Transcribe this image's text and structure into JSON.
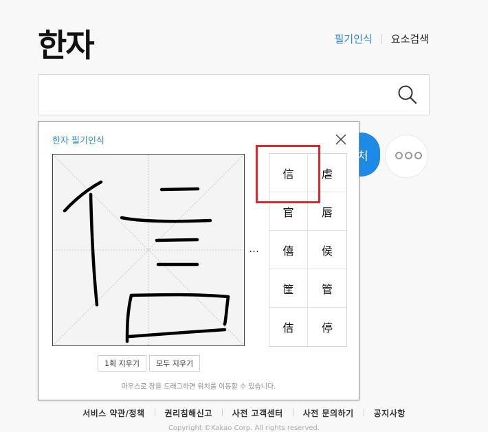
{
  "header": {
    "logo": "한자",
    "nav_handwriting": "필기인식",
    "nav_element_search": "요소검색"
  },
  "search": {
    "placeholder": "",
    "icon": "search-icon"
  },
  "side_buttons": {
    "blue_button_partial": "처",
    "more_icon": "more-icon"
  },
  "panel": {
    "title": "한자 필기인식",
    "close_icon": "close-icon",
    "more_label": "…",
    "candidates": [
      "信",
      "虐",
      "官",
      "唇",
      "僖",
      "侯",
      "筐",
      "管",
      "佶",
      "停"
    ],
    "button_undo_stroke": "1획 지우기",
    "button_clear_all": "모두 지우기",
    "hint": "마우스로 창을 드래그하면 위치를 이동할 수 있습니다."
  },
  "footer": {
    "links": [
      "서비스 약관/정책",
      "권리침해신고",
      "사전 고객센터",
      "사전 문의하기",
      "공지사항"
    ],
    "copyright": "Copyright ©Kakao Corp. All rights reserved."
  },
  "colors": {
    "accent_blue": "#2a8ad1",
    "button_blue": "#1d8be6",
    "highlight_red": "#e5232c"
  }
}
